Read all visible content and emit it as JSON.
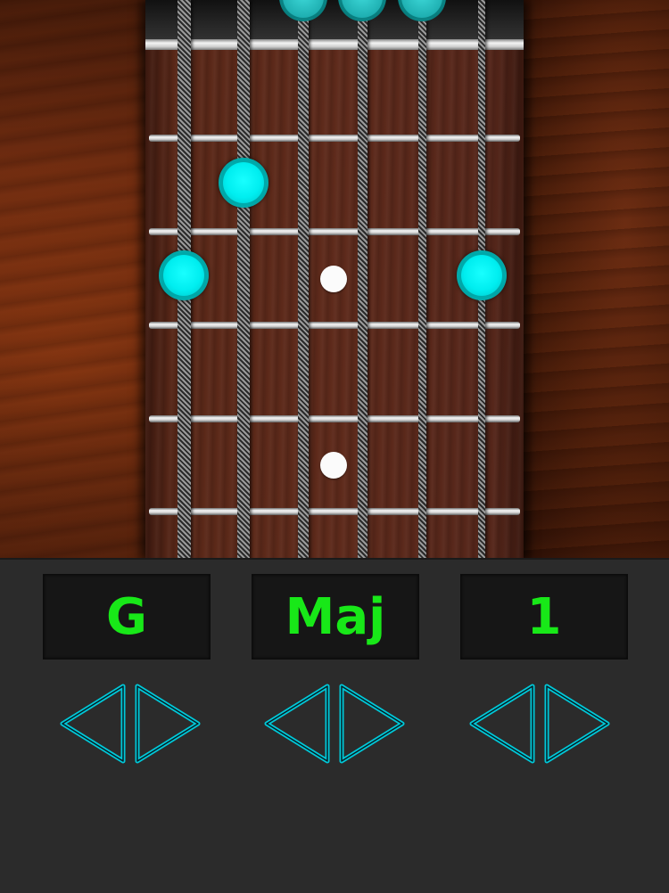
{
  "app": {
    "accent_color": "#00f0f0",
    "display_text_color": "#18e818"
  },
  "fretboard": {
    "strings": 6,
    "frets_visible": 5,
    "inlay_marker_frets": [
      3,
      5
    ],
    "chord_positions": [
      {
        "string": 6,
        "fret": 3
      },
      {
        "string": 5,
        "fret": 2
      },
      {
        "string": 1,
        "fret": 3
      }
    ],
    "open_strings": [
      4,
      3,
      2
    ]
  },
  "selectors": {
    "root": {
      "value": "G",
      "prev_icon": "triangle-left-outline-icon",
      "next_icon": "triangle-right-outline-icon"
    },
    "type": {
      "value": "Maj",
      "prev_icon": "triangle-left-outline-icon",
      "next_icon": "triangle-right-outline-icon"
    },
    "variation": {
      "value": "1",
      "prev_icon": "triangle-left-outline-icon",
      "next_icon": "triangle-right-outline-icon"
    }
  }
}
